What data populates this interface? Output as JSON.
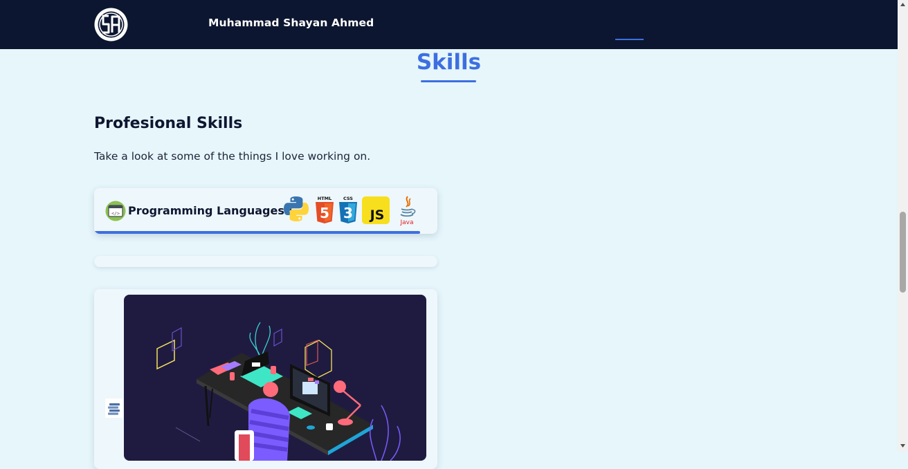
{
  "header": {
    "brand_name": "Muhammad Shayan Ahmed",
    "logo_icon": "sa-monogram-logo",
    "colors": {
      "background": "#0c1630",
      "accent": "#3d6fe0"
    }
  },
  "skills": {
    "section_title": "Skills",
    "subheading": "Profesional Skills",
    "description": "Take a look at some of the things I love working on.",
    "cards": [
      {
        "label": "Programming Languages :",
        "icon": "code-window-icon",
        "progress": 0.95,
        "languages": [
          {
            "icon": "python-icon"
          },
          {
            "icon": "html5-icon",
            "caption": "HTML",
            "badge": "5"
          },
          {
            "icon": "css3-icon",
            "caption": "CSS",
            "badge": "3"
          },
          {
            "icon": "javascript-icon",
            "badge": "JS"
          },
          {
            "icon": "java-icon",
            "caption": "Java"
          }
        ]
      },
      {
        "label": "",
        "icon": ""
      },
      {
        "icon": "database-servers-icon",
        "image": "developer-desk-illustration"
      }
    ]
  },
  "colors": {
    "page_background": "#e6f6fb",
    "card_background": "#eef7fb",
    "accent": "#3d6fe0",
    "illustration_background": "#1f1b40"
  }
}
